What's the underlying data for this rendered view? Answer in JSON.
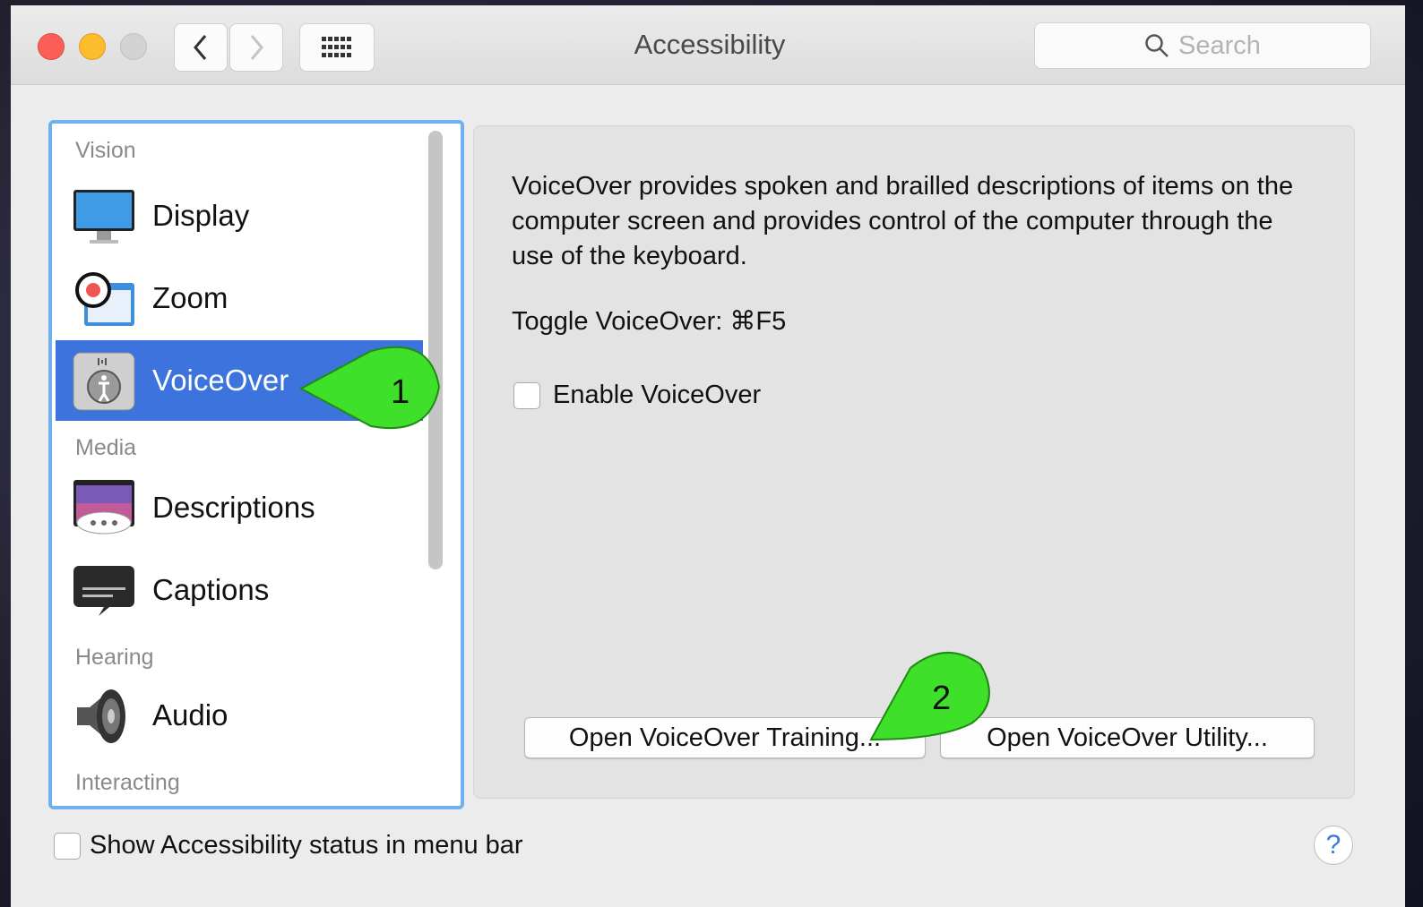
{
  "window": {
    "title": "Accessibility"
  },
  "toolbar": {
    "search_placeholder": "Search"
  },
  "sidebar": {
    "sections": [
      "Vision",
      "Media",
      "Hearing",
      "Interacting"
    ],
    "items": [
      {
        "label": "Display",
        "icon": "display-icon"
      },
      {
        "label": "Zoom",
        "icon": "zoom-icon"
      },
      {
        "label": "VoiceOver",
        "icon": "voiceover-icon",
        "selected": true
      },
      {
        "label": "Descriptions",
        "icon": "descriptions-icon"
      },
      {
        "label": "Captions",
        "icon": "captions-icon"
      },
      {
        "label": "Audio",
        "icon": "audio-icon"
      }
    ]
  },
  "content": {
    "description": "VoiceOver provides spoken and brailled descriptions of items on the computer screen and provides control of the computer through the use of the keyboard.",
    "toggle_shortcut": "Toggle VoiceOver:  ⌘F5",
    "enable_label": "Enable VoiceOver",
    "training_button": "Open VoiceOver Training...",
    "utility_button": "Open VoiceOver Utility..."
  },
  "footer": {
    "status_label": "Show Accessibility status in menu bar",
    "help_label": "?"
  },
  "annotations": {
    "callout1": "1",
    "callout2": "2"
  },
  "colors": {
    "selection": "#3c73dc",
    "callout": "#3ee02a",
    "focus_ring": "#6fb0ee"
  }
}
